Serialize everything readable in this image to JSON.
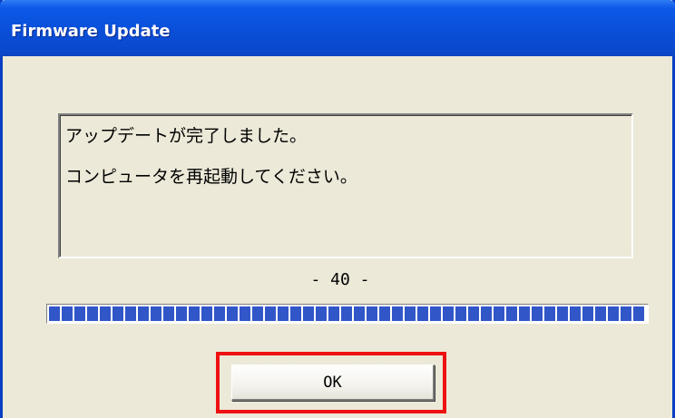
{
  "window": {
    "title": "Firmware Update"
  },
  "message": {
    "line1": "アップデートが完了しました。",
    "line2": "コンピュータを再起動してください。"
  },
  "progress": {
    "counter_text": "- 40 -",
    "fraction": 1.0
  },
  "actions": {
    "ok_label": "OK"
  },
  "colors": {
    "titlebar": "#0a4fd8",
    "dialog_bg": "#ece9d8",
    "progress_block": "#3156c8",
    "highlight": "#ee1111"
  }
}
